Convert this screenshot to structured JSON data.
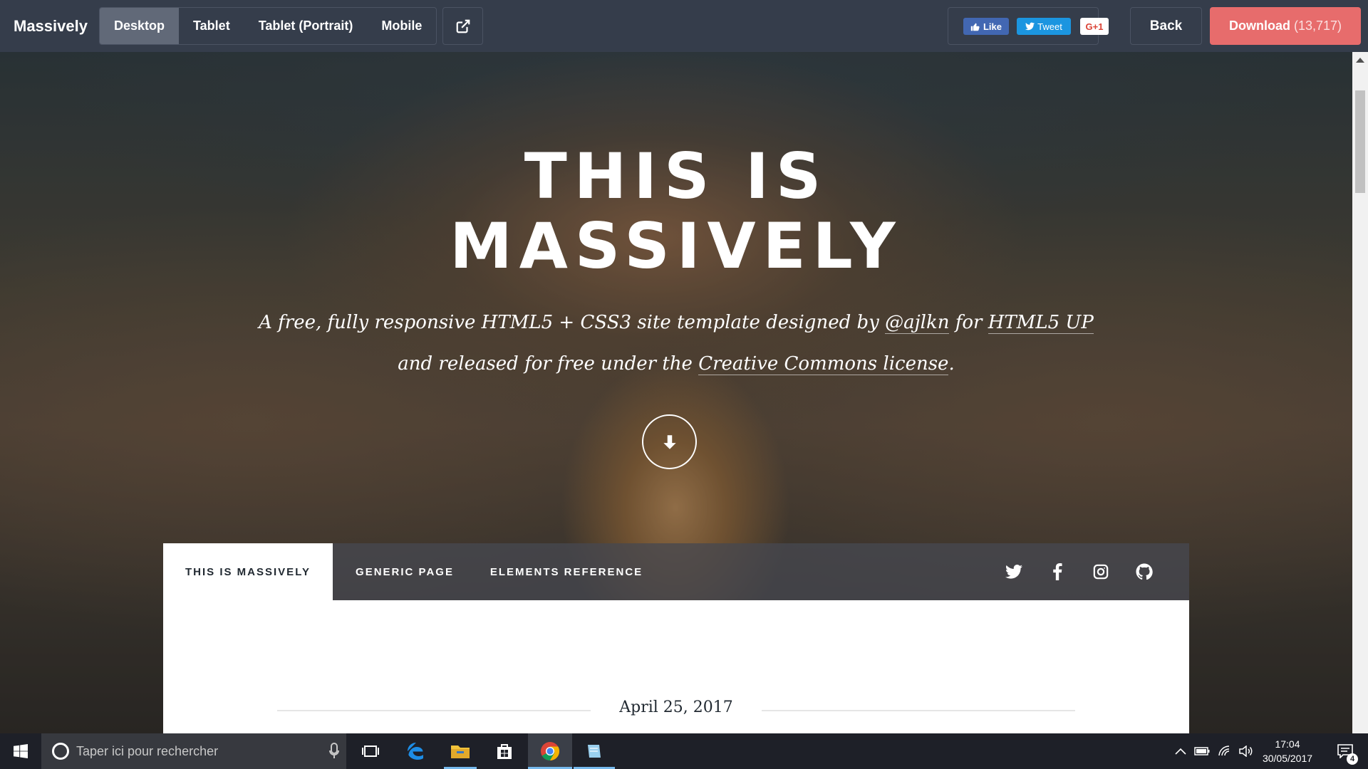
{
  "toolbar": {
    "brand": "Massively",
    "views": [
      {
        "label": "Desktop",
        "active": true
      },
      {
        "label": "Tablet",
        "active": false
      },
      {
        "label": "Tablet (Portrait)",
        "active": false
      },
      {
        "label": "Mobile",
        "active": false
      }
    ],
    "external_icon": "external-link-icon",
    "social": {
      "like": "Like",
      "tweet": "Tweet",
      "gplus": "G+1"
    },
    "back_label": "Back",
    "download_label": "Download",
    "download_count": "(13,717)",
    "download_color": "#e76c6c"
  },
  "hero": {
    "title_line1": "THIS IS",
    "title_line2": "MASSIVELY",
    "subtitle": {
      "p1": "A free, fully responsive HTML5 + CSS3 site template designed by ",
      "author": "@ajlkn",
      "p2": " for ",
      "site": "HTML5 UP",
      "p3": "and released for free under the ",
      "license": "Creative Commons license",
      "p4": "."
    },
    "scroll_icon": "arrow-down-icon"
  },
  "nav": {
    "tabs": [
      {
        "label": "THIS IS MASSIVELY",
        "active": true
      },
      {
        "label": "GENERIC PAGE",
        "active": false
      },
      {
        "label": "ELEMENTS REFERENCE",
        "active": false
      }
    ],
    "icons": [
      "twitter-icon",
      "facebook-icon",
      "instagram-icon",
      "github-icon"
    ]
  },
  "post": {
    "date": "April 25, 2017"
  },
  "taskbar": {
    "search_placeholder": "Taper ici pour rechercher",
    "apps": [
      "edge-icon",
      "file-explorer-icon",
      "store-icon",
      "chrome-icon",
      "notepad-icon"
    ],
    "time": "17:04",
    "date": "30/05/2017",
    "notifications": "4"
  }
}
